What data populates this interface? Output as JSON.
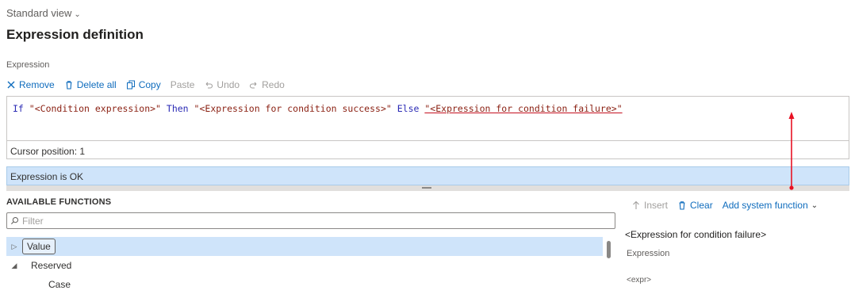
{
  "view": {
    "label": "Standard view",
    "chevron_icon": "chevron-down-icon"
  },
  "page": {
    "title": "Expression definition"
  },
  "expression": {
    "section_label": "Expression",
    "toolbar": {
      "remove": "Remove",
      "delete_all": "Delete all",
      "copy": "Copy",
      "paste": "Paste",
      "undo": "Undo",
      "redo": "Redo"
    },
    "code": {
      "if_kw": "If",
      "condition": "\"<Condition expression>\"",
      "then_kw": "Then",
      "success": "\"<Expression for condition success>\"",
      "else_kw": "Else",
      "failure": "\"<Expression for condition failure>\""
    },
    "cursor_position": "Cursor position: 1",
    "status": "Expression is OK"
  },
  "functions": {
    "title": "AVAILABLE FUNCTIONS",
    "filter_placeholder": "Filter",
    "tree": [
      {
        "label": "Value",
        "state": "collapsed",
        "selected": true
      },
      {
        "label": "Reserved",
        "state": "expanded",
        "selected": false
      },
      {
        "label": "Case",
        "state": "leaf",
        "selected": false
      }
    ]
  },
  "parameter_panel": {
    "insert": "Insert",
    "clear": "Clear",
    "add_system_function": "Add system function",
    "title": "<Expression for condition failure>",
    "description": "Expression",
    "expr": "<expr>"
  },
  "colors": {
    "accent": "#0f6cbd",
    "status_background": "#cfe4fa",
    "string_literal": "#8a1f11",
    "keyword": "#2b2bb5",
    "annotation_arrow": "#e81123"
  }
}
